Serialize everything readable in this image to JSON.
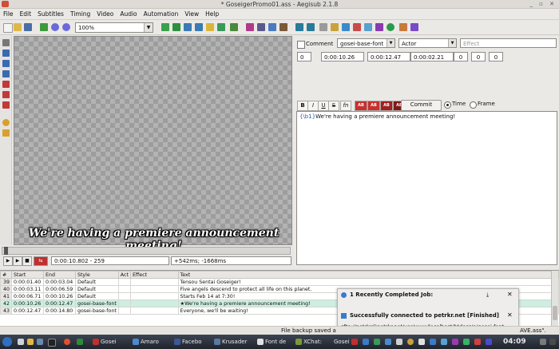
{
  "window": {
    "title": "* GoseigerPromo01.ass - Aegisub 2.1.8"
  },
  "menu": [
    "File",
    "Edit",
    "Subtitles",
    "Timing",
    "Video",
    "Audio",
    "Automation",
    "View",
    "Help"
  ],
  "toolbar": {
    "zoom_value": "100%"
  },
  "video": {
    "subtitle_text": "We're having a premiere announcement meeting!"
  },
  "video_controls": {
    "time_frame": "0:00:10.802 - 259",
    "offset": "+542ms; -1668ms"
  },
  "editor": {
    "comment_label": "Comment",
    "style_value": "gosei-base-font",
    "actor_value": "Actor",
    "effect_placeholder": "Effect",
    "layer": "0",
    "start_time": "0:00:10.26",
    "end_time": "0:00:12.47",
    "duration": "0:00:02.21",
    "margin_l": "0",
    "margin_r": "0",
    "margin_v": "0",
    "bold": "B",
    "italic": "I",
    "underline": "U",
    "strike": "S",
    "font": "fn",
    "color_labels": [
      "AB",
      "AB",
      "AB",
      "AB"
    ],
    "commit_label": "Commit",
    "time_label": "Time",
    "frame_label": "Frame",
    "text_tag": "{\\b1}",
    "text_body": "We're having a premiere announcement meeting!"
  },
  "grid": {
    "columns": [
      "#",
      "Start",
      "End",
      "Style",
      "Act",
      "Effect",
      "Text"
    ],
    "rows": [
      {
        "num": "39",
        "start": "0:00:01.40",
        "end": "0:00:03.04",
        "style": "Default",
        "act": "",
        "effect": "",
        "text": "Tensou Sentai Goseiger!"
      },
      {
        "num": "40",
        "start": "0:00:03.11",
        "end": "0:00:06.59",
        "style": "Default",
        "act": "",
        "effect": "",
        "text": "Five angels descend to protect all life on this planet."
      },
      {
        "num": "41",
        "start": "0:00:06.71",
        "end": "0:00:10.26",
        "style": "Default",
        "act": "",
        "effect": "",
        "text": "Starts Feb 14 at 7:30!"
      },
      {
        "num": "42",
        "start": "0:00:10.26",
        "end": "0:00:12.47",
        "style": "gosei-base-font",
        "act": "",
        "effect": "",
        "text": "★We're having a premiere announcement meeting!"
      },
      {
        "num": "43",
        "start": "0:00:12.47",
        "end": "0:00:14.80",
        "style": "gosei-base-font",
        "act": "",
        "effect": "",
        "text": "Everyone, we'll be waiting!"
      }
    ]
  },
  "notification": {
    "header": "1 Recently Completed Job:",
    "title": "Successfully connected to petrkr.net [Finished]",
    "detail": "sftp://petrkr@petrkr.net/var/www/localhost/htdocs/a/gosei-font-"
  },
  "status": {
    "left": "File backup saved a",
    "right": "AVE.ass\"."
  },
  "taskbar": {
    "tasks": [
      "Gosei",
      "Amaro",
      "Facebo",
      "Krusader",
      "Font de",
      "XChat:",
      "Gosei"
    ],
    "clock": "04:09"
  }
}
